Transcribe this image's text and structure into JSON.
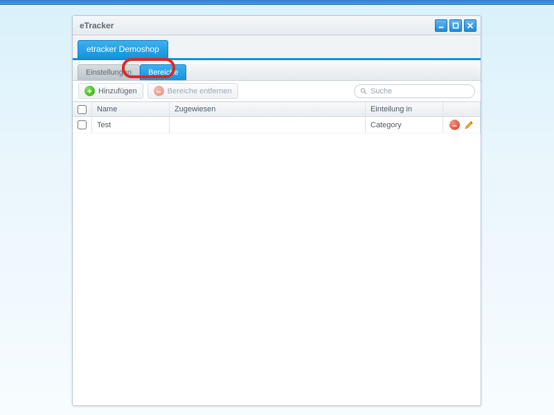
{
  "window": {
    "title": "eTracker"
  },
  "shopTab": {
    "label": "etracker Demoshop"
  },
  "subTabs": {
    "settings": "Einstellungen",
    "areas": "Bereiche"
  },
  "toolbar": {
    "add": "Hinzufügen",
    "remove": "Bereiche entfernen"
  },
  "search": {
    "placeholder": "Suche"
  },
  "columns": {
    "name": "Name",
    "assigned": "Zugewiesen",
    "division": "Einteilung in"
  },
  "rows": [
    {
      "name": "Test",
      "assigned": "",
      "division": "Category"
    }
  ]
}
